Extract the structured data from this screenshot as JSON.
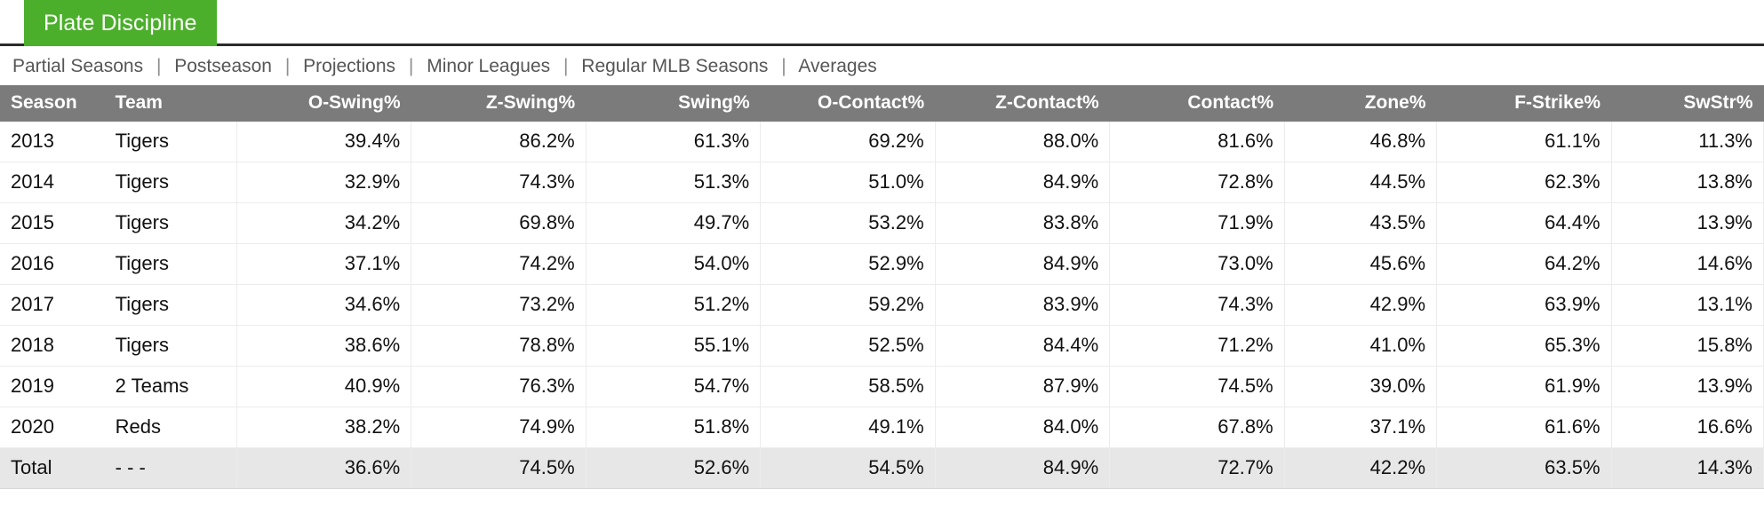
{
  "header": {
    "active_tab": "Plate Discipline",
    "accent_color": "#4caf2c"
  },
  "subnav": {
    "separator": "|",
    "items": [
      "Partial Seasons",
      "Postseason",
      "Projections",
      "Minor Leagues",
      "Regular MLB Seasons",
      "Averages"
    ]
  },
  "table": {
    "columns": [
      "Season",
      "Team",
      "O-Swing%",
      "Z-Swing%",
      "Swing%",
      "O-Contact%",
      "Z-Contact%",
      "Contact%",
      "Zone%",
      "F-Strike%",
      "SwStr%"
    ],
    "rows": [
      {
        "season": "2013",
        "team": "Tigers",
        "o_swing": "39.4%",
        "z_swing": "86.2%",
        "swing": "61.3%",
        "o_contact": "69.2%",
        "z_contact": "88.0%",
        "contact": "81.6%",
        "zone": "46.8%",
        "f_strike": "61.1%",
        "swstr": "11.3%"
      },
      {
        "season": "2014",
        "team": "Tigers",
        "o_swing": "32.9%",
        "z_swing": "74.3%",
        "swing": "51.3%",
        "o_contact": "51.0%",
        "z_contact": "84.9%",
        "contact": "72.8%",
        "zone": "44.5%",
        "f_strike": "62.3%",
        "swstr": "13.8%"
      },
      {
        "season": "2015",
        "team": "Tigers",
        "o_swing": "34.2%",
        "z_swing": "69.8%",
        "swing": "49.7%",
        "o_contact": "53.2%",
        "z_contact": "83.8%",
        "contact": "71.9%",
        "zone": "43.5%",
        "f_strike": "64.4%",
        "swstr": "13.9%"
      },
      {
        "season": "2016",
        "team": "Tigers",
        "o_swing": "37.1%",
        "z_swing": "74.2%",
        "swing": "54.0%",
        "o_contact": "52.9%",
        "z_contact": "84.9%",
        "contact": "73.0%",
        "zone": "45.6%",
        "f_strike": "64.2%",
        "swstr": "14.6%"
      },
      {
        "season": "2017",
        "team": "Tigers",
        "o_swing": "34.6%",
        "z_swing": "73.2%",
        "swing": "51.2%",
        "o_contact": "59.2%",
        "z_contact": "83.9%",
        "contact": "74.3%",
        "zone": "42.9%",
        "f_strike": "63.9%",
        "swstr": "13.1%"
      },
      {
        "season": "2018",
        "team": "Tigers",
        "o_swing": "38.6%",
        "z_swing": "78.8%",
        "swing": "55.1%",
        "o_contact": "52.5%",
        "z_contact": "84.4%",
        "contact": "71.2%",
        "zone": "41.0%",
        "f_strike": "65.3%",
        "swstr": "15.8%"
      },
      {
        "season": "2019",
        "team": "2 Teams",
        "o_swing": "40.9%",
        "z_swing": "76.3%",
        "swing": "54.7%",
        "o_contact": "58.5%",
        "z_contact": "87.9%",
        "contact": "74.5%",
        "zone": "39.0%",
        "f_strike": "61.9%",
        "swstr": "13.9%"
      },
      {
        "season": "2020",
        "team": "Reds",
        "o_swing": "38.2%",
        "z_swing": "74.9%",
        "swing": "51.8%",
        "o_contact": "49.1%",
        "z_contact": "84.0%",
        "contact": "67.8%",
        "zone": "37.1%",
        "f_strike": "61.6%",
        "swstr": "16.6%"
      }
    ],
    "total_row": {
      "season": "Total",
      "team": "- - -",
      "o_swing": "36.6%",
      "z_swing": "74.5%",
      "swing": "52.6%",
      "o_contact": "54.5%",
      "z_contact": "84.9%",
      "contact": "72.7%",
      "zone": "42.2%",
      "f_strike": "63.5%",
      "swstr": "14.3%"
    }
  }
}
